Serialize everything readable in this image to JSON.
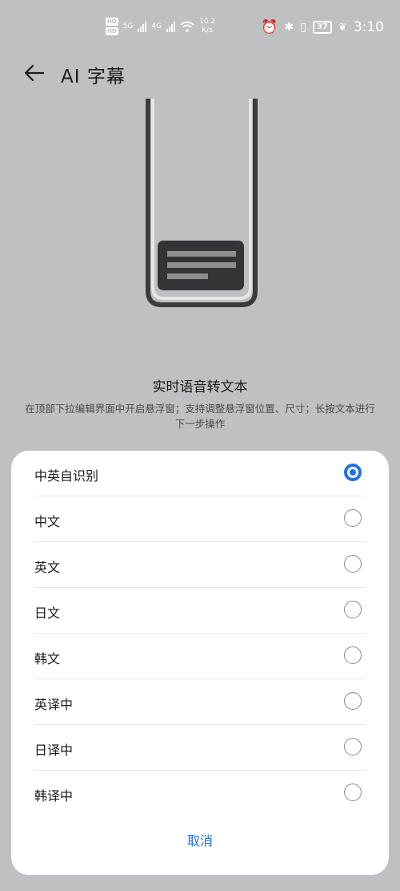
{
  "status_bar": {
    "hd1": "HD",
    "hd2": "HD",
    "sim1": "5G",
    "sim2": "4G",
    "net_speed": "10.2",
    "net_unit": "K/s",
    "battery": "37",
    "time": "3:10"
  },
  "header": {
    "title": "AI 字幕"
  },
  "illustration": {
    "title": "实时语音转文本",
    "description": "在顶部下拉编辑界面中开启悬浮窗；支持调整悬浮窗位置、尺寸；长按文本进行下一步操作"
  },
  "sheet": {
    "options": [
      {
        "label": "中英自识别",
        "selected": true
      },
      {
        "label": "中文",
        "selected": false
      },
      {
        "label": "英文",
        "selected": false
      },
      {
        "label": "日文",
        "selected": false
      },
      {
        "label": "韩文",
        "selected": false
      },
      {
        "label": "英译中",
        "selected": false
      },
      {
        "label": "日译中",
        "selected": false
      },
      {
        "label": "韩译中",
        "selected": false
      }
    ],
    "cancel_label": "取消"
  },
  "colors": {
    "accent": "#1f6fe5",
    "background": "#bfc0c2",
    "sheet": "#ffffff"
  }
}
